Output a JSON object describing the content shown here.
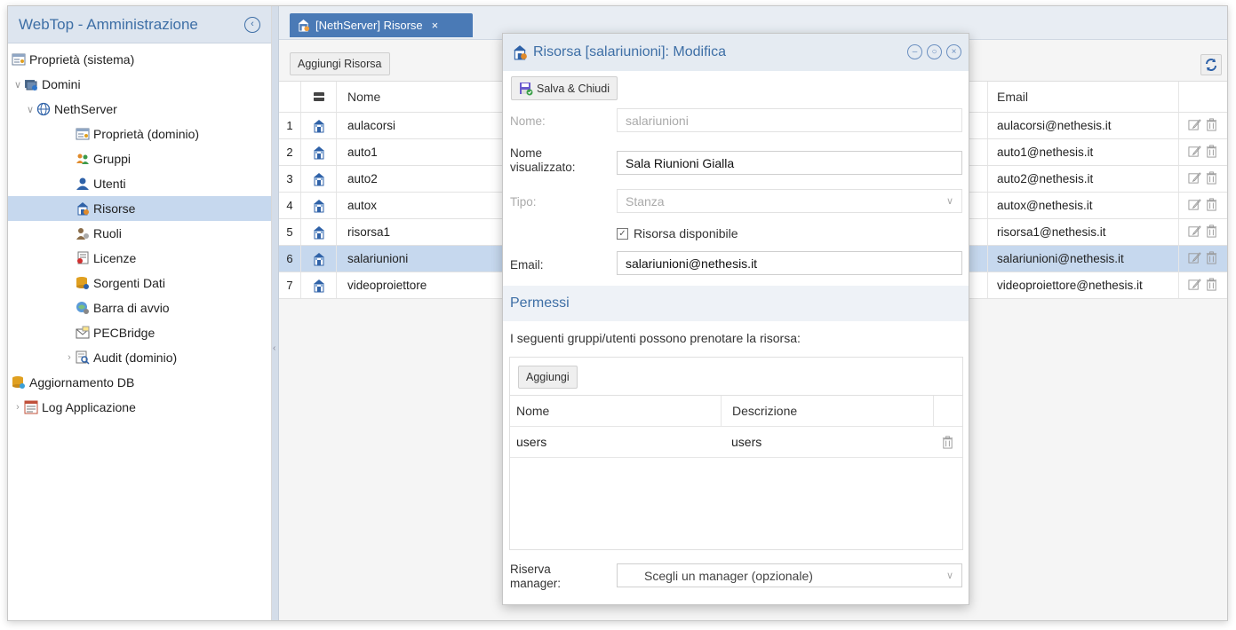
{
  "sidebar": {
    "title": "WebTop - Amministrazione",
    "collapse_icon": "chevron-left-circle-icon",
    "items": [
      {
        "label": "Proprietà (sistema)",
        "icon": "properties-icon",
        "level": 0
      },
      {
        "label": "Domini",
        "icon": "domains-icon",
        "level": 0,
        "expanded": true
      },
      {
        "label": "NethServer",
        "icon": "globe-icon",
        "level": 1,
        "expanded": true
      },
      {
        "label": "Proprietà (dominio)",
        "icon": "properties-icon",
        "level": 2
      },
      {
        "label": "Gruppi",
        "icon": "groups-icon",
        "level": 2
      },
      {
        "label": "Utenti",
        "icon": "users-icon",
        "level": 2
      },
      {
        "label": "Risorse",
        "icon": "resources-icon",
        "level": 2,
        "selected": true
      },
      {
        "label": "Ruoli",
        "icon": "roles-icon",
        "level": 2
      },
      {
        "label": "Licenze",
        "icon": "licenses-icon",
        "level": 2
      },
      {
        "label": "Sorgenti Dati",
        "icon": "datasources-icon",
        "level": 2
      },
      {
        "label": "Barra di avvio",
        "icon": "launcher-icon",
        "level": 2
      },
      {
        "label": "PECBridge",
        "icon": "pecbridge-icon",
        "level": 2
      },
      {
        "label": "Audit (dominio)",
        "icon": "audit-icon",
        "level": 2,
        "collapsed": true
      },
      {
        "label": "Aggiornamento DB",
        "icon": "db-upgrade-icon",
        "level": 0
      },
      {
        "label": "Log Applicazione",
        "icon": "log-icon",
        "level": 0,
        "collapsed": true
      }
    ]
  },
  "main": {
    "tab": {
      "label": "[NethServer] Risorse",
      "close": "×"
    },
    "toolbar": {
      "add_label": "Aggiungi Risorsa"
    },
    "grid": {
      "headers": {
        "name": "Nome",
        "email": "Email"
      },
      "rows": [
        {
          "num": "1",
          "name": "aulacorsi",
          "email": "aulacorsi@nethesis.it"
        },
        {
          "num": "2",
          "name": "auto1",
          "email": "auto1@nethesis.it"
        },
        {
          "num": "3",
          "name": "auto2",
          "email": "auto2@nethesis.it"
        },
        {
          "num": "4",
          "name": "autox",
          "email": "autox@nethesis.it"
        },
        {
          "num": "5",
          "name": "risorsa1",
          "email": "risorsa1@nethesis.it"
        },
        {
          "num": "6",
          "name": "salariunioni",
          "email": "salariunioni@nethesis.it",
          "selected": true
        },
        {
          "num": "7",
          "name": "videoproiettore",
          "email": "videoproiettore@nethesis.it"
        }
      ]
    }
  },
  "dialog": {
    "title": "Risorsa [salariunioni]: Modifica",
    "save_label": "Salva & Chiudi",
    "form": {
      "name_label": "Nome:",
      "name_value": "salariunioni",
      "display_label_1": "Nome",
      "display_label_2": "visualizzato:",
      "display_value": "Sala Riunioni Gialla",
      "type_label": "Tipo:",
      "type_value": "Stanza",
      "available_label": "Risorsa disponibile",
      "email_label": "Email:",
      "email_value": "salariunioni@nethesis.it"
    },
    "permissions": {
      "title": "Permessi",
      "description": "I seguenti gruppi/utenti possono prenotare la risorsa:",
      "add_label": "Aggiungi",
      "headers": {
        "name": "Nome",
        "desc": "Descrizione"
      },
      "rows": [
        {
          "name": "users",
          "desc": "users"
        }
      ]
    },
    "manager": {
      "label_1": "Riserva",
      "label_2": "manager:",
      "placeholder": "Scegli un manager (opzionale)"
    }
  },
  "colors": {
    "accent": "#3e6fa6",
    "tab_bg": "#4a7ab6",
    "selection": "#c6d8ee",
    "header_bg": "#dde5ef"
  }
}
